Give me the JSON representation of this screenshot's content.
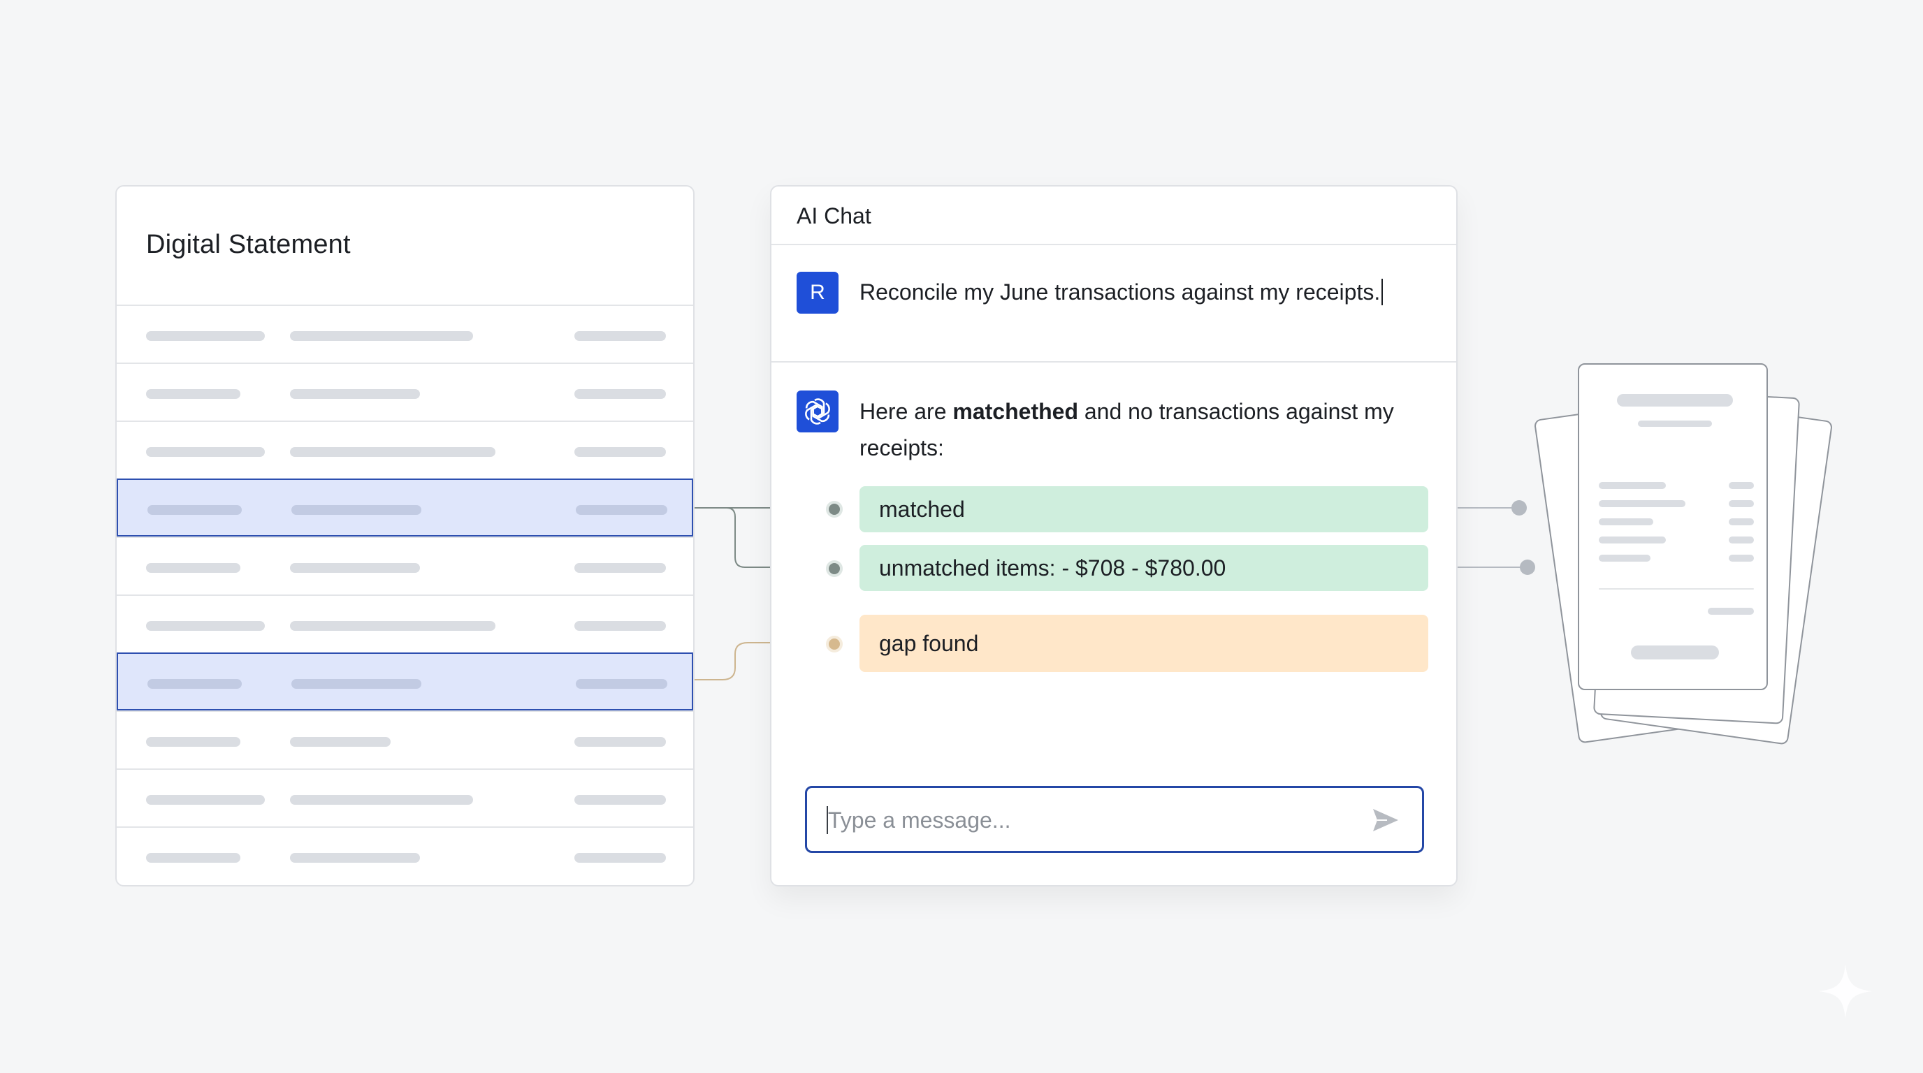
{
  "statement": {
    "title": "Digital Statement",
    "rows": [
      {
        "highlighted": false
      },
      {
        "highlighted": false
      },
      {
        "highlighted": false
      },
      {
        "highlighted": true
      },
      {
        "highlighted": false
      },
      {
        "highlighted": false
      },
      {
        "highlighted": true
      },
      {
        "highlighted": false
      },
      {
        "highlighted": false
      },
      {
        "highlighted": false
      }
    ]
  },
  "chat": {
    "title": "AI Chat",
    "user": {
      "avatar_letter": "R",
      "message": "Reconcile my June transactions against my receipts."
    },
    "assistant": {
      "avatar_icon": "openai-logo-icon",
      "intro_before": "Here are ",
      "intro_bold": "matchethed",
      "intro_after": " and no transactions against my receipts:",
      "results": [
        {
          "label": "matched",
          "status": "green"
        },
        {
          "label": "unmatched items: - $708 - $780.00",
          "status": "green"
        },
        {
          "label": "gap found",
          "status": "orange"
        }
      ]
    },
    "input": {
      "placeholder": "Type a message...",
      "send_icon": "send-icon"
    }
  },
  "colors": {
    "accent": "#1f4fd8",
    "highlight_row": "#dfe6fb",
    "matched_green": "#cfeedd",
    "gap_orange": "#ffe7c9"
  }
}
